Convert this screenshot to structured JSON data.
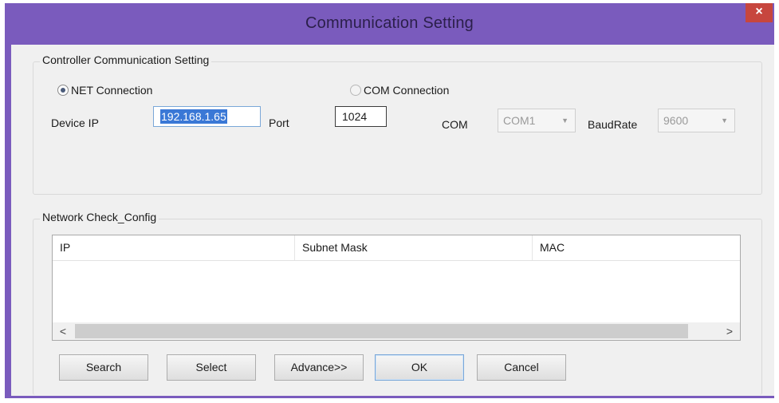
{
  "window": {
    "title": "Communication Setting",
    "close_symbol": "×"
  },
  "controller_group": {
    "title": "Controller Communication Setting",
    "net_label": "NET Connection",
    "com_label": "COM Connection",
    "net_selected": true,
    "device_ip_label": "Device IP",
    "device_ip_value": "192.168.1.65",
    "port_label": "Port",
    "port_value": "1024",
    "com_label_short": "COM",
    "com_value": "COM1",
    "baudrate_label": "BaudRate",
    "baudrate_value": "9600"
  },
  "network_group": {
    "title": "Network Check_Config",
    "columns": [
      "IP",
      "Subnet Mask",
      "MAC"
    ],
    "scroll_left": "<",
    "scroll_right": ">"
  },
  "buttons": {
    "search": "Search",
    "select": "Select",
    "advance": "Advance>>",
    "ok": "OK",
    "cancel": "Cancel"
  },
  "icons": {
    "dropdown": "▼",
    "close": "close-icon"
  }
}
